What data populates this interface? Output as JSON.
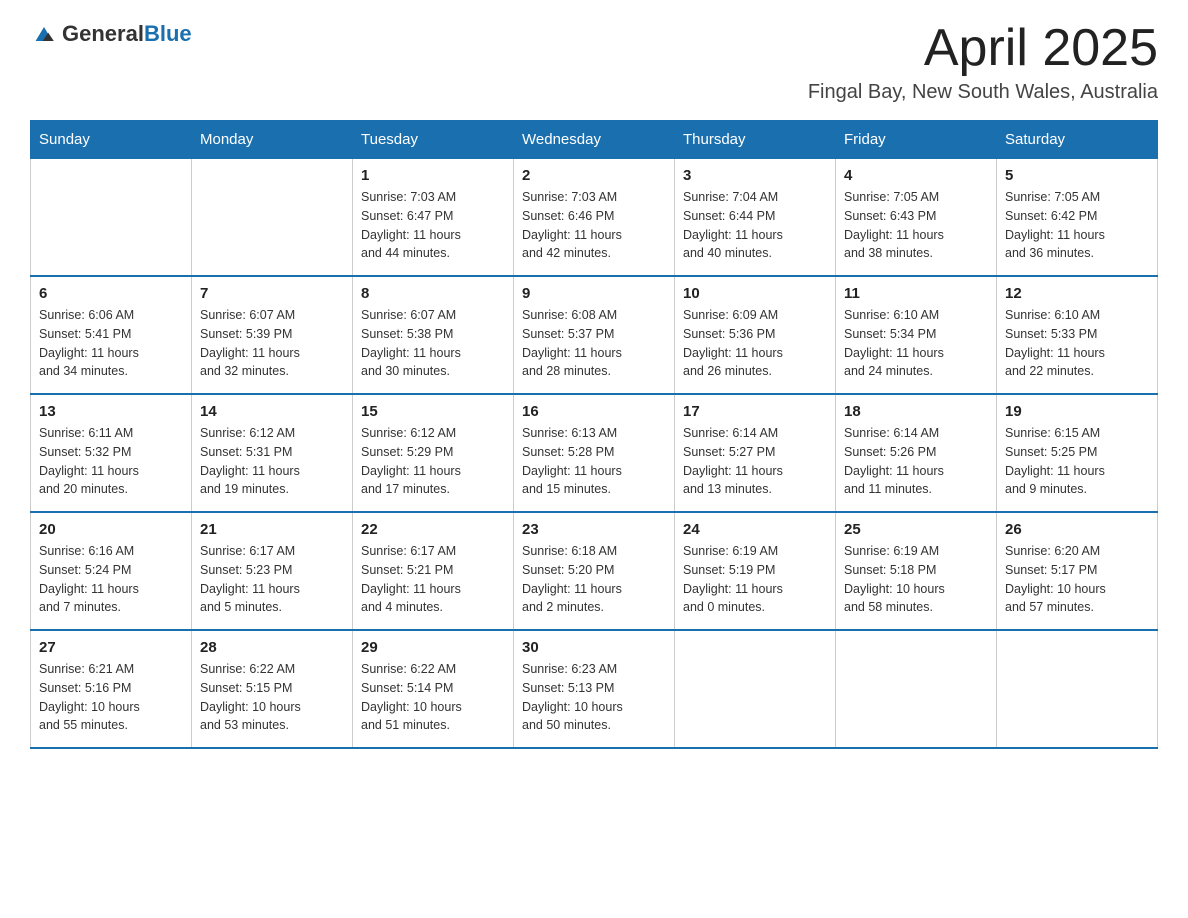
{
  "header": {
    "logo_general": "General",
    "logo_blue": "Blue",
    "month_title": "April 2025",
    "location": "Fingal Bay, New South Wales, Australia"
  },
  "weekdays": [
    "Sunday",
    "Monday",
    "Tuesday",
    "Wednesday",
    "Thursday",
    "Friday",
    "Saturday"
  ],
  "weeks": [
    [
      {
        "day": "",
        "info": ""
      },
      {
        "day": "",
        "info": ""
      },
      {
        "day": "1",
        "info": "Sunrise: 7:03 AM\nSunset: 6:47 PM\nDaylight: 11 hours\nand 44 minutes."
      },
      {
        "day": "2",
        "info": "Sunrise: 7:03 AM\nSunset: 6:46 PM\nDaylight: 11 hours\nand 42 minutes."
      },
      {
        "day": "3",
        "info": "Sunrise: 7:04 AM\nSunset: 6:44 PM\nDaylight: 11 hours\nand 40 minutes."
      },
      {
        "day": "4",
        "info": "Sunrise: 7:05 AM\nSunset: 6:43 PM\nDaylight: 11 hours\nand 38 minutes."
      },
      {
        "day": "5",
        "info": "Sunrise: 7:05 AM\nSunset: 6:42 PM\nDaylight: 11 hours\nand 36 minutes."
      }
    ],
    [
      {
        "day": "6",
        "info": "Sunrise: 6:06 AM\nSunset: 5:41 PM\nDaylight: 11 hours\nand 34 minutes."
      },
      {
        "day": "7",
        "info": "Sunrise: 6:07 AM\nSunset: 5:39 PM\nDaylight: 11 hours\nand 32 minutes."
      },
      {
        "day": "8",
        "info": "Sunrise: 6:07 AM\nSunset: 5:38 PM\nDaylight: 11 hours\nand 30 minutes."
      },
      {
        "day": "9",
        "info": "Sunrise: 6:08 AM\nSunset: 5:37 PM\nDaylight: 11 hours\nand 28 minutes."
      },
      {
        "day": "10",
        "info": "Sunrise: 6:09 AM\nSunset: 5:36 PM\nDaylight: 11 hours\nand 26 minutes."
      },
      {
        "day": "11",
        "info": "Sunrise: 6:10 AM\nSunset: 5:34 PM\nDaylight: 11 hours\nand 24 minutes."
      },
      {
        "day": "12",
        "info": "Sunrise: 6:10 AM\nSunset: 5:33 PM\nDaylight: 11 hours\nand 22 minutes."
      }
    ],
    [
      {
        "day": "13",
        "info": "Sunrise: 6:11 AM\nSunset: 5:32 PM\nDaylight: 11 hours\nand 20 minutes."
      },
      {
        "day": "14",
        "info": "Sunrise: 6:12 AM\nSunset: 5:31 PM\nDaylight: 11 hours\nand 19 minutes."
      },
      {
        "day": "15",
        "info": "Sunrise: 6:12 AM\nSunset: 5:29 PM\nDaylight: 11 hours\nand 17 minutes."
      },
      {
        "day": "16",
        "info": "Sunrise: 6:13 AM\nSunset: 5:28 PM\nDaylight: 11 hours\nand 15 minutes."
      },
      {
        "day": "17",
        "info": "Sunrise: 6:14 AM\nSunset: 5:27 PM\nDaylight: 11 hours\nand 13 minutes."
      },
      {
        "day": "18",
        "info": "Sunrise: 6:14 AM\nSunset: 5:26 PM\nDaylight: 11 hours\nand 11 minutes."
      },
      {
        "day": "19",
        "info": "Sunrise: 6:15 AM\nSunset: 5:25 PM\nDaylight: 11 hours\nand 9 minutes."
      }
    ],
    [
      {
        "day": "20",
        "info": "Sunrise: 6:16 AM\nSunset: 5:24 PM\nDaylight: 11 hours\nand 7 minutes."
      },
      {
        "day": "21",
        "info": "Sunrise: 6:17 AM\nSunset: 5:23 PM\nDaylight: 11 hours\nand 5 minutes."
      },
      {
        "day": "22",
        "info": "Sunrise: 6:17 AM\nSunset: 5:21 PM\nDaylight: 11 hours\nand 4 minutes."
      },
      {
        "day": "23",
        "info": "Sunrise: 6:18 AM\nSunset: 5:20 PM\nDaylight: 11 hours\nand 2 minutes."
      },
      {
        "day": "24",
        "info": "Sunrise: 6:19 AM\nSunset: 5:19 PM\nDaylight: 11 hours\nand 0 minutes."
      },
      {
        "day": "25",
        "info": "Sunrise: 6:19 AM\nSunset: 5:18 PM\nDaylight: 10 hours\nand 58 minutes."
      },
      {
        "day": "26",
        "info": "Sunrise: 6:20 AM\nSunset: 5:17 PM\nDaylight: 10 hours\nand 57 minutes."
      }
    ],
    [
      {
        "day": "27",
        "info": "Sunrise: 6:21 AM\nSunset: 5:16 PM\nDaylight: 10 hours\nand 55 minutes."
      },
      {
        "day": "28",
        "info": "Sunrise: 6:22 AM\nSunset: 5:15 PM\nDaylight: 10 hours\nand 53 minutes."
      },
      {
        "day": "29",
        "info": "Sunrise: 6:22 AM\nSunset: 5:14 PM\nDaylight: 10 hours\nand 51 minutes."
      },
      {
        "day": "30",
        "info": "Sunrise: 6:23 AM\nSunset: 5:13 PM\nDaylight: 10 hours\nand 50 minutes."
      },
      {
        "day": "",
        "info": ""
      },
      {
        "day": "",
        "info": ""
      },
      {
        "day": "",
        "info": ""
      }
    ]
  ]
}
